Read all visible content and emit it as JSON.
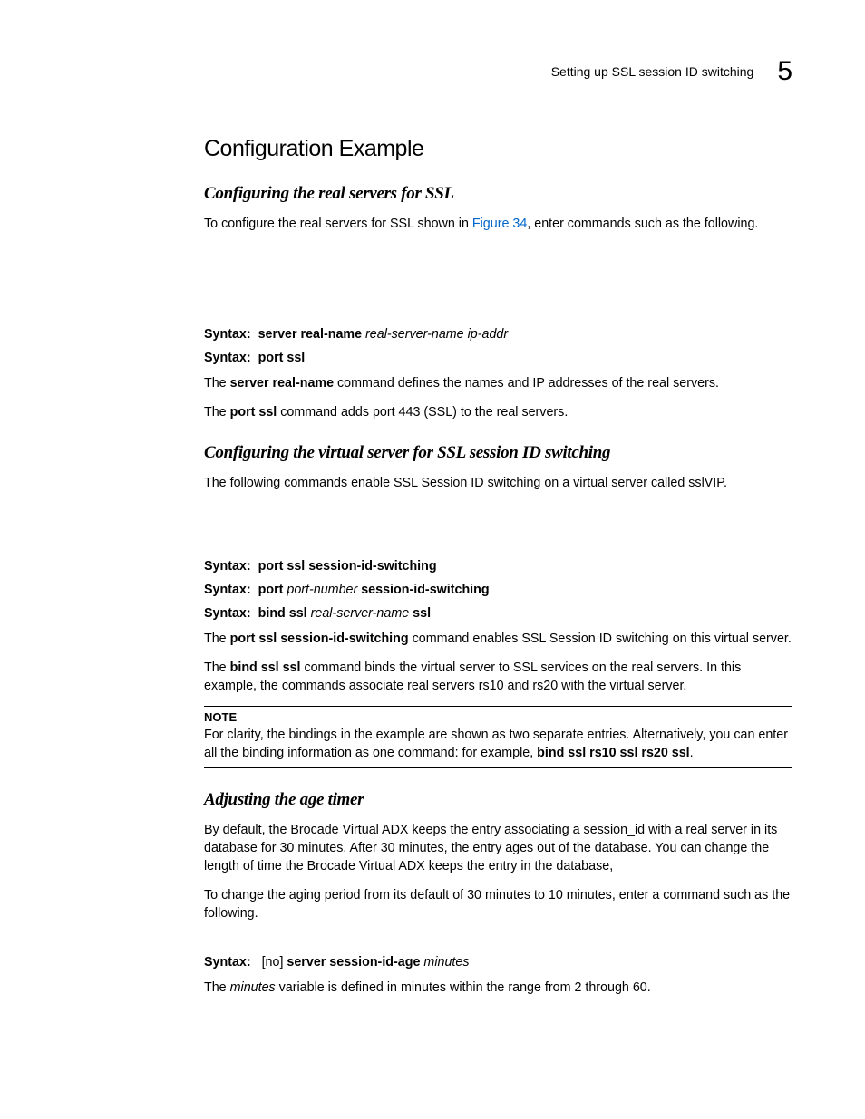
{
  "header": {
    "text": "Setting up SSL session ID switching",
    "chapter": "5"
  },
  "title": "Configuration Example",
  "section1": {
    "heading": "Configuring the real servers for SSL",
    "intro_prefix": "To configure the real servers for SSL shown in ",
    "intro_link": "Figure 34",
    "intro_suffix": ", enter commands such as the following.",
    "syntax1_label": "Syntax:",
    "syntax1_cmd": "server real-name",
    "syntax1_args": "real-server-name ip-addr",
    "syntax2_label": "Syntax:",
    "syntax2_cmd": "port ssl",
    "sentence1_pre": "The ",
    "sentence1_bold": "server real-name",
    "sentence1_post": " command defines the names and IP addresses of the real servers.",
    "sentence2_pre": "The ",
    "sentence2_bold": "port ssl",
    "sentence2_post": " command adds port 443 (SSL) to the real servers."
  },
  "section2": {
    "heading": "Configuring the virtual server for SSL session ID switching",
    "intro": "The following commands enable SSL Session ID switching on a virtual server called sslVIP.",
    "syntax1_label": "Syntax:",
    "syntax1_cmd": "port ssl session-id-switching",
    "syntax2_label": "Syntax:",
    "syntax2_cmd_pre": "port ",
    "syntax2_arg": "port-number",
    "syntax2_cmd_post": " session-id-switching",
    "syntax3_label": "Syntax:",
    "syntax3_cmd_pre": "bind ssl ",
    "syntax3_arg": "real-server-name",
    "syntax3_cmd_post": " ssl",
    "sentence1_pre": "The ",
    "sentence1_bold": "port ssl session-id-switching",
    "sentence1_post": " command enables SSL Session ID switching on this virtual server.",
    "sentence2_pre": "The ",
    "sentence2_bold": "bind ssl ssl",
    "sentence2_post": " command binds the virtual server to SSL services on the real servers. In this example, the commands associate real servers rs10 and rs20 with the virtual server.",
    "note_label": "NOTE",
    "note_text_pre": "For clarity, the bindings in the example are shown as two separate entries. Alternatively, you can enter all the binding information as one command: for example, ",
    "note_text_bold": "bind ssl rs10 ssl rs20 ssl",
    "note_text_post": "."
  },
  "section3": {
    "heading": "Adjusting the age timer",
    "para1": "By default, the Brocade Virtual ADX keeps the entry associating a session_id with a real server in its database for 30 minutes. After 30 minutes, the entry ages out of the database. You can change the length of time the Brocade Virtual ADX keeps the entry in the database,",
    "para2": "To change the aging period from its default of 30 minutes to 10 minutes, enter a command such as the following.",
    "syntax_label": "Syntax:",
    "syntax_no": "[no] ",
    "syntax_cmd": "server session-id-age",
    "syntax_arg": "minutes",
    "closing_pre": "The ",
    "closing_ital": "minutes",
    "closing_post": " variable is defined in minutes within the range from 2 through 60."
  }
}
